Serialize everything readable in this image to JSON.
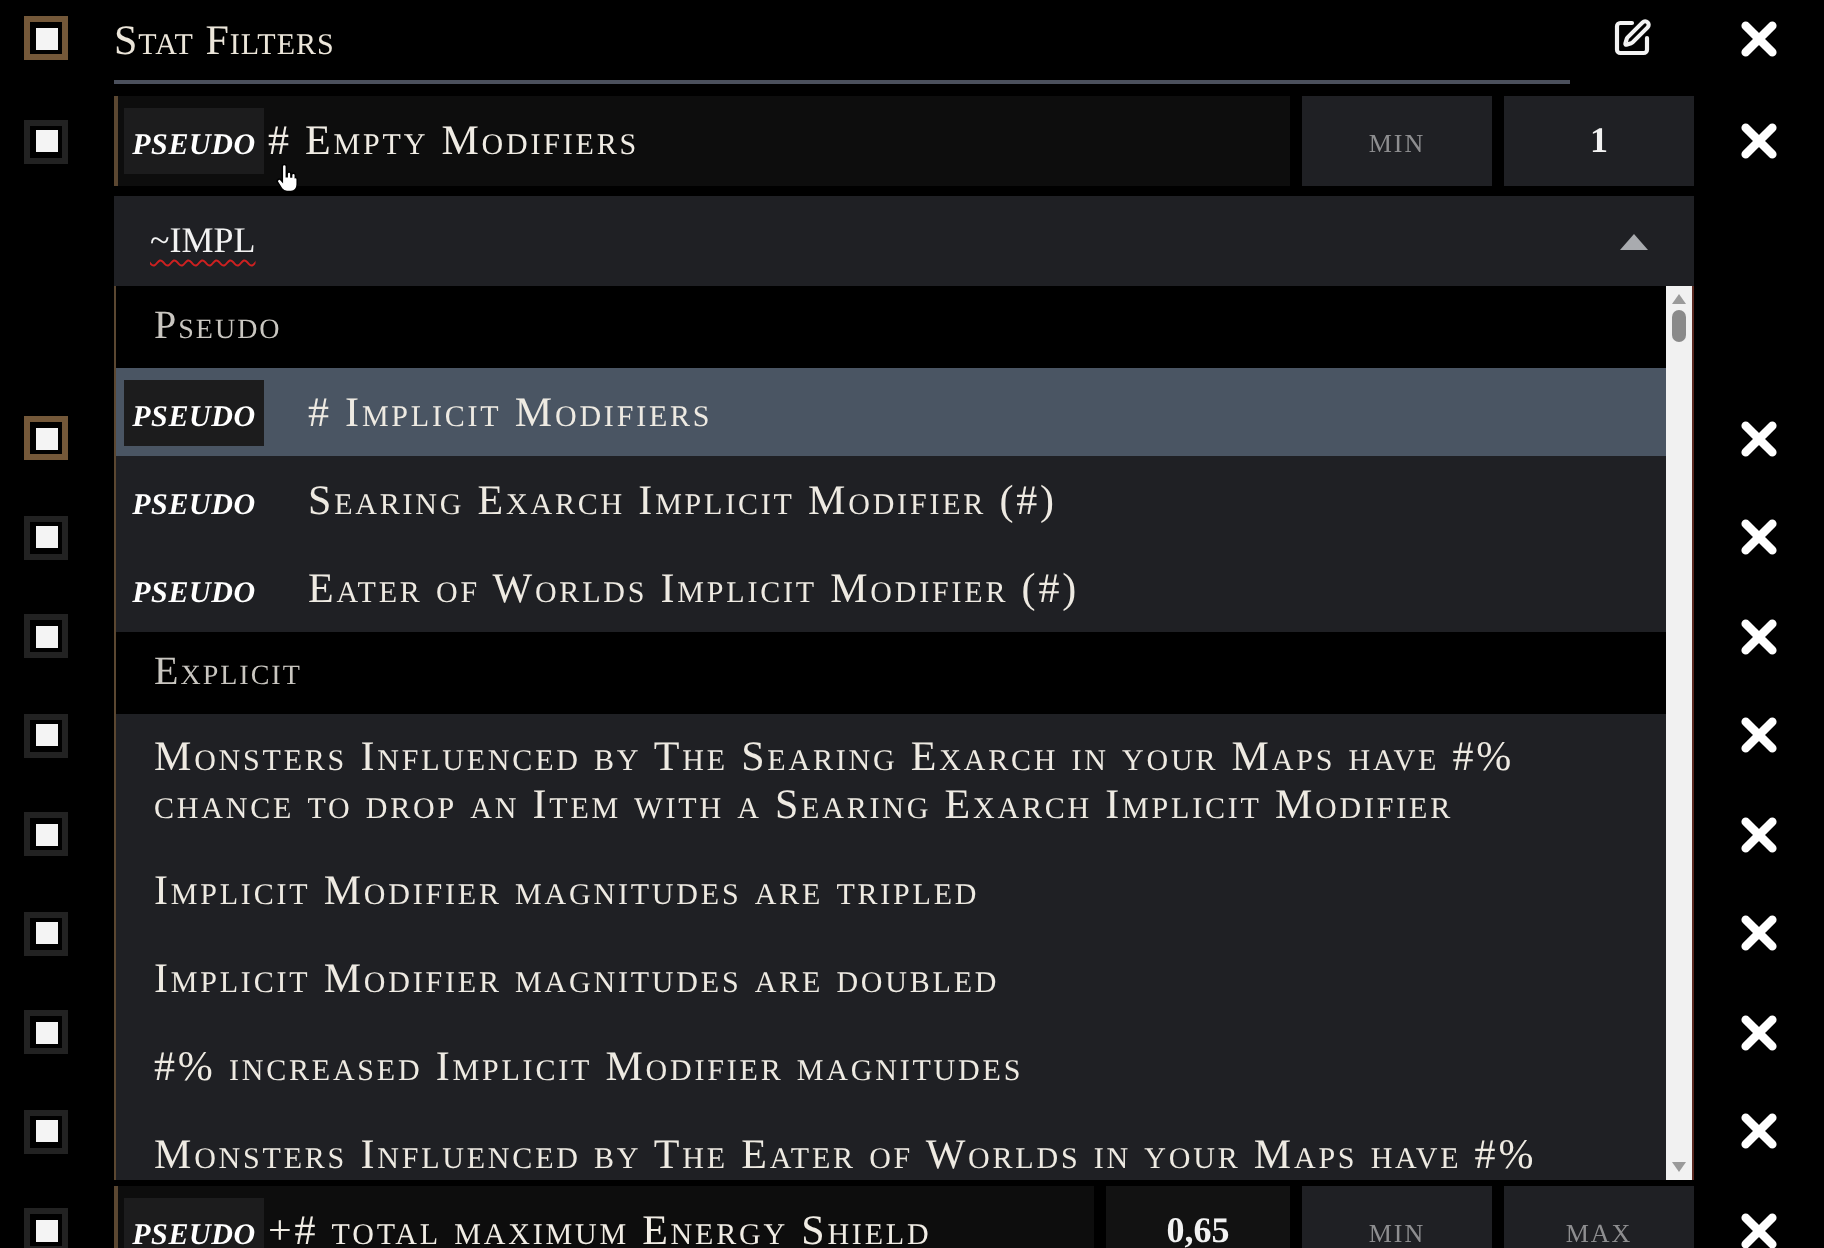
{
  "header": {
    "title": "Stat Filters",
    "checked": true,
    "hovered": true
  },
  "top_filter": {
    "checked": true,
    "hovered": false,
    "tag": "pseudo",
    "text": "# Empty Modifiers",
    "fields": [
      {
        "kind": "input",
        "placeholder": "min"
      },
      {
        "kind": "input",
        "value": "1"
      }
    ]
  },
  "covered_rows": [
    {
      "checked": true,
      "hovered": true
    },
    {
      "checked": true,
      "hovered": false
    },
    {
      "checked": true,
      "hovered": false
    },
    {
      "checked": true,
      "hovered": false
    },
    {
      "checked": true,
      "hovered": false
    },
    {
      "checked": true,
      "hovered": false
    },
    {
      "checked": true,
      "hovered": false
    },
    {
      "checked": true,
      "hovered": false
    }
  ],
  "bottom_filter": {
    "checked": true,
    "hovered": false,
    "tag": "pseudo",
    "text": "+# total maximum Energy Shield",
    "fields": [
      {
        "kind": "weight",
        "value": "0,65"
      },
      {
        "kind": "input",
        "placeholder": "min"
      },
      {
        "kind": "input",
        "placeholder": "max"
      }
    ]
  },
  "dropdown": {
    "query": "~IMPL",
    "expanded": true,
    "groups": [
      {
        "label": "Pseudo",
        "options": [
          {
            "tag": "pseudo",
            "text": "# Implicit Modifiers",
            "selected": true
          },
          {
            "tag": "pseudo",
            "text": "Searing Exarch Implicit Modifier (#)",
            "selected": false
          },
          {
            "tag": "pseudo",
            "text": "Eater of Worlds Implicit Modifier (#)",
            "selected": false
          }
        ]
      },
      {
        "label": "Explicit",
        "options": [
          {
            "text": "Monsters Influenced by The Searing Exarch in your Maps have #% chance to drop an Item with a Searing Exarch Implicit Modifier",
            "selected": false
          },
          {
            "text": "Implicit Modifier magnitudes are tripled",
            "selected": false
          },
          {
            "text": "Implicit Modifier magnitudes are doubled",
            "selected": false
          },
          {
            "text": "#% increased Implicit Modifier magnitudes",
            "selected": false
          },
          {
            "text": "Monsters Influenced by The Eater of Worlds in your Maps have #%",
            "selected": false
          }
        ]
      }
    ]
  }
}
